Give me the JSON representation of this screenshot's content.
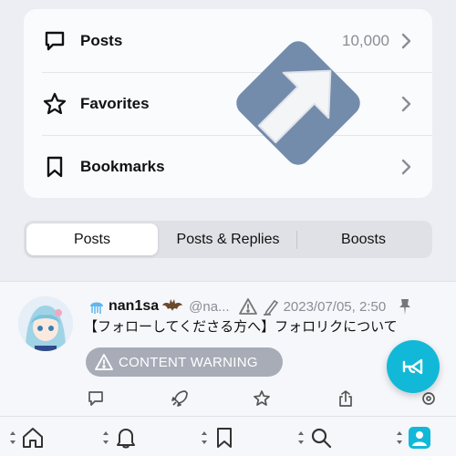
{
  "menu": {
    "items": [
      {
        "icon": "speech-bubble-icon",
        "label": "Posts",
        "count": "10,000"
      },
      {
        "icon": "star-icon",
        "label": "Favorites",
        "count": ""
      },
      {
        "icon": "bookmark-icon",
        "label": "Bookmarks",
        "count": ""
      }
    ]
  },
  "segmented": {
    "tabs": [
      {
        "label": "Posts",
        "active": true
      },
      {
        "label": "Posts & Replies",
        "active": false
      },
      {
        "label": "Boosts",
        "active": false
      }
    ]
  },
  "post": {
    "display_name": "nan1sa",
    "handle": "@na...",
    "timestamp": "2023/07/05, 2:50",
    "text": "【フォローしてくださる方へ】フォロリクについて",
    "content_warning_label": "CONTENT WARNING",
    "actions": [
      "reply-icon",
      "boost-icon",
      "favorite-icon",
      "share-icon",
      "more-icon"
    ]
  },
  "fab": {
    "icon": "trumpet-icon"
  },
  "tabbar": {
    "items": [
      "home-icon",
      "notifications-bell-icon",
      "bookmark-icon",
      "search-icon",
      "profile-icon"
    ]
  },
  "colors": {
    "accent": "#12b8d8",
    "badge": "#6b86a8",
    "content_warning_bg": "#a7acb7",
    "muted_text": "#8a8d96"
  }
}
